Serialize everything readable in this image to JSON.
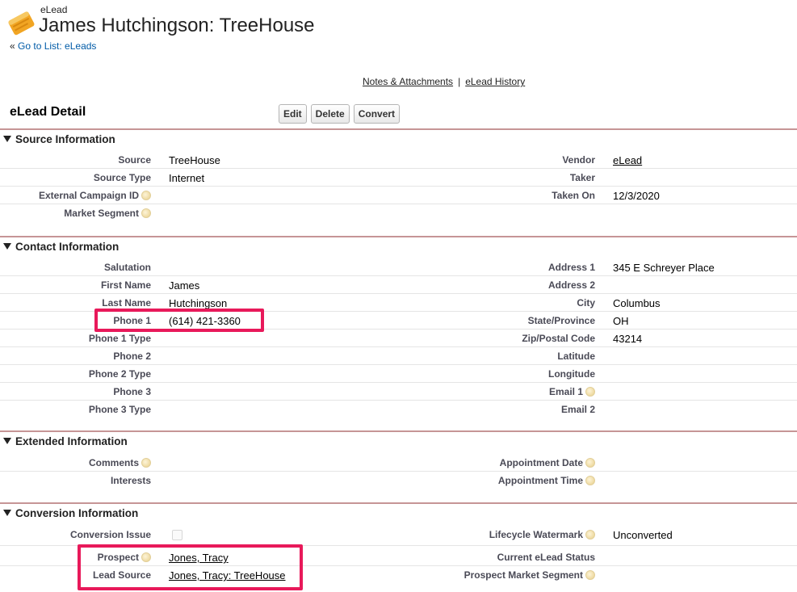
{
  "header": {
    "object_type": "eLead",
    "title": "James Hutchingson: TreeHouse",
    "back_prefix": "« ",
    "back_link": "Go to List: eLeads"
  },
  "related_links": {
    "notes": "Notes & Attachments",
    "separator": "|",
    "history": "eLead History"
  },
  "detail": {
    "title": "eLead Detail",
    "buttons": {
      "edit": "Edit",
      "delete": "Delete",
      "convert": "Convert"
    }
  },
  "sections": {
    "source": {
      "title": "Source Information",
      "fields": {
        "source": {
          "label": "Source",
          "value": "TreeHouse"
        },
        "vendor": {
          "label": "Vendor",
          "value": "eLead"
        },
        "source_type": {
          "label": "Source Type",
          "value": "Internet"
        },
        "taker": {
          "label": "Taker",
          "value": ""
        },
        "external_campaign_id": {
          "label": "External Campaign ID",
          "value": ""
        },
        "taken_on": {
          "label": "Taken On",
          "value": "12/3/2020"
        },
        "market_segment": {
          "label": "Market Segment",
          "value": ""
        }
      }
    },
    "contact": {
      "title": "Contact Information",
      "fields": {
        "salutation": {
          "label": "Salutation",
          "value": ""
        },
        "address1": {
          "label": "Address 1",
          "value": "345 E Schreyer Place"
        },
        "first_name": {
          "label": "First Name",
          "value": "James"
        },
        "address2": {
          "label": "Address 2",
          "value": ""
        },
        "last_name": {
          "label": "Last Name",
          "value": "Hutchingson"
        },
        "city": {
          "label": "City",
          "value": "Columbus"
        },
        "phone1": {
          "label": "Phone 1",
          "value": "(614) 421-3360"
        },
        "state": {
          "label": "State/Province",
          "value": "OH"
        },
        "phone1_type": {
          "label": "Phone 1 Type",
          "value": ""
        },
        "zip": {
          "label": "Zip/Postal Code",
          "value": "43214"
        },
        "phone2": {
          "label": "Phone 2",
          "value": ""
        },
        "latitude": {
          "label": "Latitude",
          "value": ""
        },
        "phone2_type": {
          "label": "Phone 2 Type",
          "value": ""
        },
        "longitude": {
          "label": "Longitude",
          "value": ""
        },
        "phone3": {
          "label": "Phone 3",
          "value": ""
        },
        "email1": {
          "label": "Email 1",
          "value": ""
        },
        "phone3_type": {
          "label": "Phone 3 Type",
          "value": ""
        },
        "email2": {
          "label": "Email 2",
          "value": ""
        }
      }
    },
    "extended": {
      "title": "Extended Information",
      "fields": {
        "comments": {
          "label": "Comments",
          "value": ""
        },
        "appointment_date": {
          "label": "Appointment Date",
          "value": ""
        },
        "interests": {
          "label": "Interests",
          "value": ""
        },
        "appointment_time": {
          "label": "Appointment Time",
          "value": ""
        }
      }
    },
    "conversion": {
      "title": "Conversion Information",
      "fields": {
        "conversion_issue": {
          "label": "Conversion Issue",
          "checked": false
        },
        "lifecycle_watermark": {
          "label": "Lifecycle Watermark",
          "value": "Unconverted"
        },
        "prospect": {
          "label": "Prospect",
          "value": "Jones, Tracy"
        },
        "current_status": {
          "label": "Current eLead Status",
          "value": ""
        },
        "lead_source": {
          "label": "Lead Source",
          "value": "Jones, Tracy: TreeHouse"
        },
        "prospect_market_segment": {
          "label": "Prospect Market Segment",
          "value": ""
        }
      }
    }
  },
  "colors": {
    "section_rule": "#c69596",
    "highlight": "#e8195a",
    "link": "#015ba7",
    "label": "#4a4a56"
  },
  "icons": {
    "logo": "elead-notepad-icon",
    "help": "help-bubble-icon",
    "collapse": "triangle-down-icon"
  }
}
